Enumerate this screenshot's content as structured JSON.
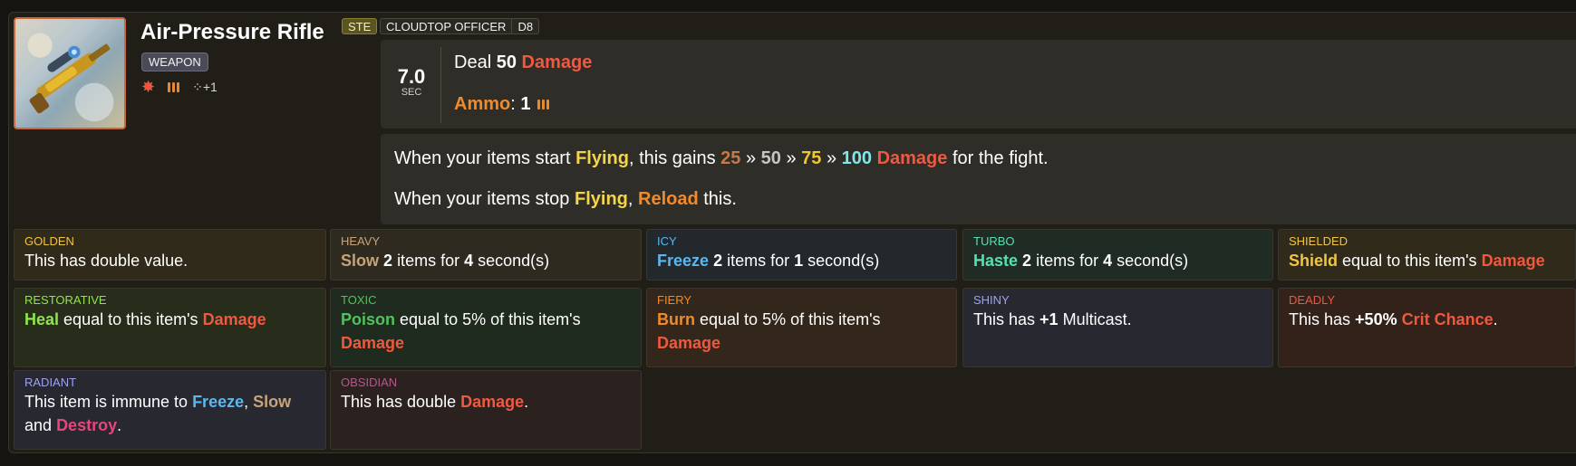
{
  "item": {
    "title": "Air-Pressure Rifle",
    "type_tag": "WEAPON",
    "tags": {
      "ste": "STE",
      "hero": "CLOUDTOP OFFICER",
      "size": "D8"
    },
    "icons": [
      "damage-burst-icon",
      "ammo-icon",
      "multicast-icon"
    ],
    "multicast_label": "+1",
    "cooldown": {
      "value": "7.0",
      "unit": "SEC"
    },
    "main": {
      "deal": "Deal",
      "damage_value": "50",
      "damage_word": "Damage",
      "ammo_label": "Ammo",
      "colon": ":",
      "ammo_value": "1"
    },
    "desc": {
      "l1_a": "When your items start",
      "flying": "Flying",
      "l1_b": ", this gains",
      "v25": "25",
      "sep": "»",
      "v50": "50",
      "v75": "75",
      "v100": "100",
      "damage": "Damage",
      "l1_c": "for the fight.",
      "l2_a": "When your items stop",
      "l2_b": ",",
      "reload": "Reload",
      "l2_c": "this."
    }
  },
  "enchantments": [
    {
      "name": "GOLDEN",
      "text": "This has double value."
    },
    {
      "name": "HEAVY",
      "kw": "Slow",
      "n1": "2",
      "mid": "items for",
      "n2": "4",
      "end": "second(s)"
    },
    {
      "name": "ICY",
      "kw": "Freeze",
      "n1": "2",
      "mid": "items for",
      "n2": "1",
      "end": "second(s)"
    },
    {
      "name": "TURBO",
      "kw": "Haste",
      "n1": "2",
      "mid": "items for",
      "n2": "4",
      "end": "second(s)"
    },
    {
      "name": "SHIELDED",
      "kw": "Shield",
      "mid": "equal to this item's",
      "dmg": "Damage"
    },
    {
      "name": "RESTORATIVE",
      "kw": "Heal",
      "mid": "equal to this item's",
      "dmg": "Damage"
    },
    {
      "name": "TOXIC",
      "kw": "Poison",
      "mid": "equal to 5% of this item's",
      "dmg": "Damage"
    },
    {
      "name": "FIERY",
      "kw": "Burn",
      "mid": "equal to 5% of this item's",
      "dmg": "Damage"
    },
    {
      "name": "SHINY",
      "pre": "This has",
      "val": "+1",
      "post": "Multicast."
    },
    {
      "name": "DEADLY",
      "pre": "This has",
      "val": "+50%",
      "kw": "Crit Chance",
      "post": "."
    },
    {
      "name": "RADIANT",
      "pre": "This item is immune to",
      "k1": "Freeze",
      "comma": ",",
      "k2": "Slow",
      "and": "and",
      "k3": "Destroy",
      "post": "."
    },
    {
      "name": "OBSIDIAN",
      "pre": "This has double",
      "dmg": "Damage",
      "post": "."
    }
  ],
  "colors": {
    "damage": "#f0583f",
    "ammo": "#f08a2a",
    "flying": "#f5d548",
    "golden": "#f1c444",
    "heavy": "#c8a37a",
    "icy": "#5ab8ef",
    "turbo": "#56e0b0",
    "restorative": "#8fe64a",
    "toxic": "#4fc35c",
    "shiny": "#9ea3f0",
    "deadly": "#f0583f",
    "radiant": "#9ea3f0",
    "obsidian": "#b05a8a"
  }
}
